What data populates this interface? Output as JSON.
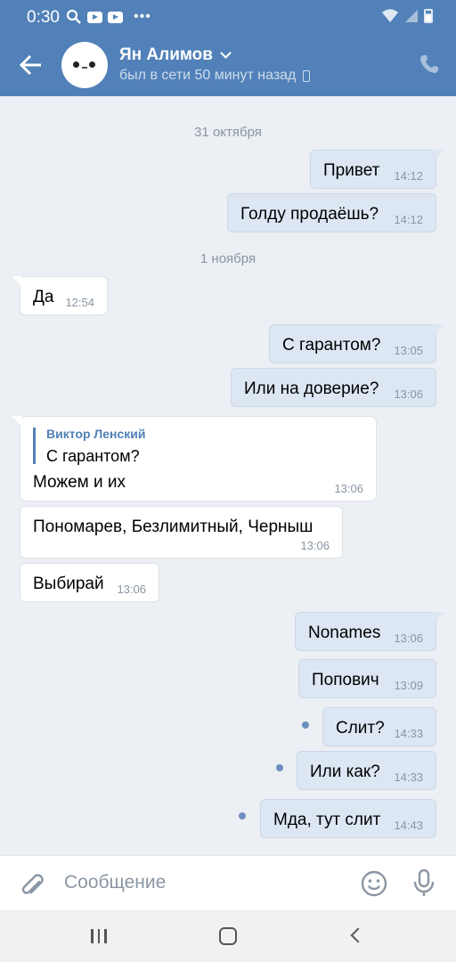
{
  "status_bar": {
    "time": "0:30"
  },
  "header": {
    "contact_name": "Ян Алимов",
    "last_seen": "был в сети 50 минут назад"
  },
  "messages": [
    {
      "type": "date",
      "text": "31 октября"
    },
    {
      "dir": "out",
      "text": "Привет",
      "time": "14:12"
    },
    {
      "dir": "out",
      "text": "Голду продаёшь?",
      "time": "14:12"
    },
    {
      "type": "date",
      "text": "1 ноября"
    },
    {
      "dir": "in",
      "text": "Да",
      "time": "12:54"
    },
    {
      "dir": "out",
      "text": "С гарантом?",
      "time": "13:05"
    },
    {
      "dir": "out",
      "text": "Или на доверие?",
      "time": "13:06"
    },
    {
      "dir": "in",
      "text": "Можем и их",
      "time": "13:06",
      "quote": {
        "author": "Виктор Ленский",
        "text": "С гарантом?"
      }
    },
    {
      "dir": "in",
      "text": "Пономарев, Безлимитный, Черныш",
      "time": "13:06"
    },
    {
      "dir": "in",
      "text": "Выбирай",
      "time": "13:06"
    },
    {
      "dir": "out",
      "text": "Nonames",
      "time": "13:06"
    },
    {
      "dir": "out",
      "text": "Попович",
      "time": "13:09"
    },
    {
      "dir": "out",
      "text": "Слит?",
      "time": "14:33",
      "unread": true
    },
    {
      "dir": "out",
      "text": "Или как?",
      "time": "14:33",
      "unread": true
    },
    {
      "dir": "out",
      "text": "Мда, тут слит",
      "time": "14:43",
      "unread": true
    }
  ],
  "composer": {
    "placeholder": "Сообщение"
  },
  "colors": {
    "header": "#5181b8",
    "outgoing_bubble": "#dde7f4",
    "incoming_bubble": "#ffffff",
    "background": "#eceff3"
  },
  "icons": [
    "search-icon",
    "youtube-icon",
    "wifi-icon",
    "signal-icon",
    "battery-icon",
    "back-arrow-icon",
    "chevron-down-icon",
    "mobile-icon",
    "call-icon",
    "attach-icon",
    "emoji-icon",
    "mic-icon",
    "recents-icon",
    "home-icon",
    "nav-back-icon"
  ]
}
